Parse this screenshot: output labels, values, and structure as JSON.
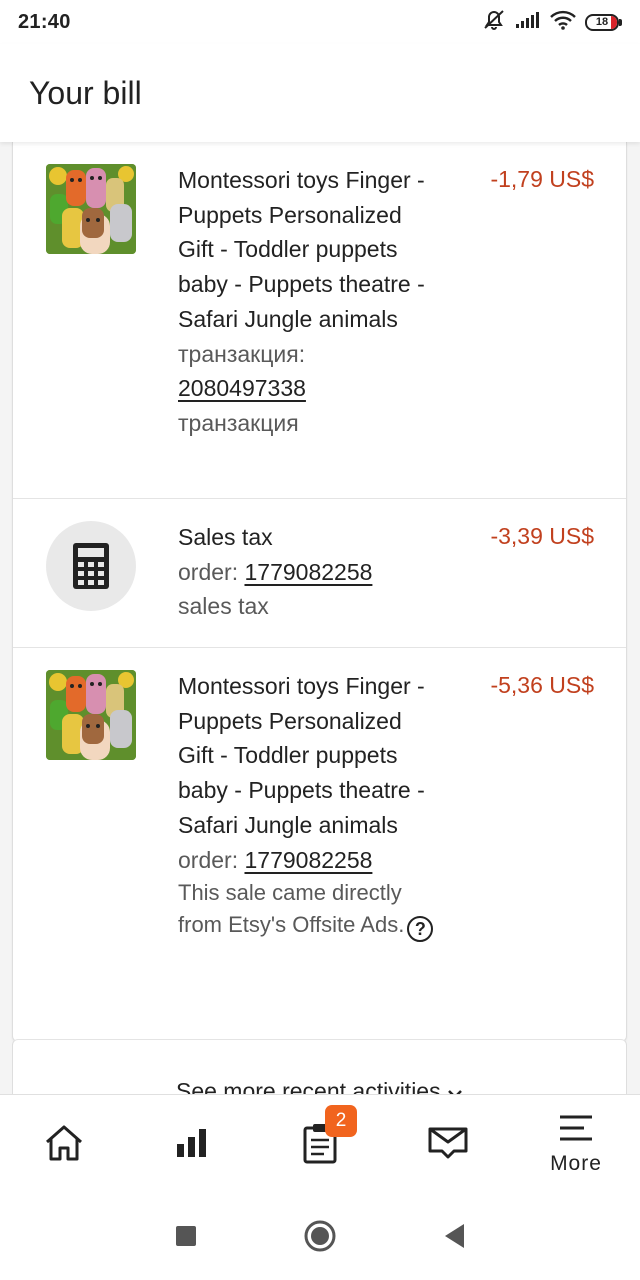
{
  "status_bar": {
    "time": "21:40",
    "battery": "18"
  },
  "header": {
    "title": "Your bill"
  },
  "items": [
    {
      "title": "Montessori toys Finger - Puppets Personalized Gift - Toddler puppets baby - Puppets theatre - Safari Jungle animals",
      "amount": "-1,79 US$",
      "ref_label": "транзакция:",
      "ref_number": "2080497338",
      "type_label": "транзакция"
    },
    {
      "title": "Sales tax",
      "amount": "-3,39 US$",
      "ref_label": "order:",
      "ref_number": "1779082258",
      "type_label": "sales tax"
    },
    {
      "title": "Montessori toys Finger - Puppets Personalized Gift - Toddler puppets baby - Puppets theatre - Safari Jungle animals",
      "amount": "-5,36 US$",
      "ref_label": "order:",
      "ref_number": "1779082258",
      "note": "This sale came directly from Etsy's Offsite Ads."
    }
  ],
  "see_more": {
    "label": "See more recent activities"
  },
  "bottom_nav": {
    "items": [
      {
        "icon": "home-icon"
      },
      {
        "icon": "stats-icon"
      },
      {
        "icon": "orders-icon",
        "badge": "2"
      },
      {
        "icon": "messages-icon"
      },
      {
        "icon": "menu-icon",
        "label": "More"
      }
    ]
  },
  "colors": {
    "amount": "#c1401e",
    "badge": "#f1641e",
    "text": "#222222",
    "muted": "#595959"
  }
}
